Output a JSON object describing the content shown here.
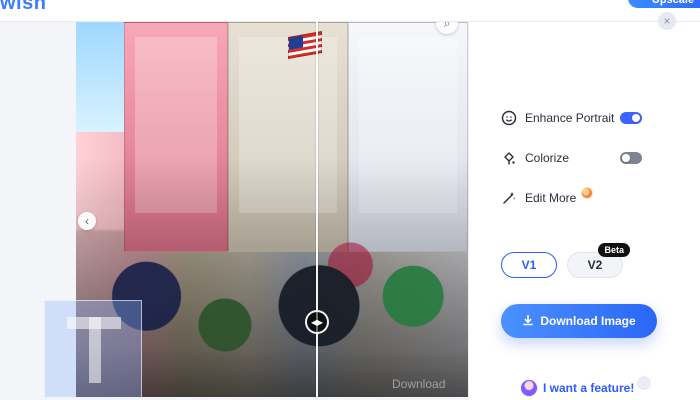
{
  "header": {
    "brand": "wish",
    "cta": "Upscale"
  },
  "image": {
    "download_faint": "Download"
  },
  "panel": {
    "options": [
      {
        "label": "Enhance Portrait",
        "icon": "face-icon",
        "toggle": "on"
      },
      {
        "label": "Colorize",
        "icon": "bucket-icon",
        "toggle": "off"
      },
      {
        "label": "Edit More",
        "icon": "wand-icon",
        "badge": "fire-icon"
      }
    ],
    "versions": [
      {
        "label": "V1",
        "active": true
      },
      {
        "label": "V2",
        "badge": "Beta"
      }
    ],
    "download_button": "Download Image",
    "feature_link": "I want a feature!"
  }
}
